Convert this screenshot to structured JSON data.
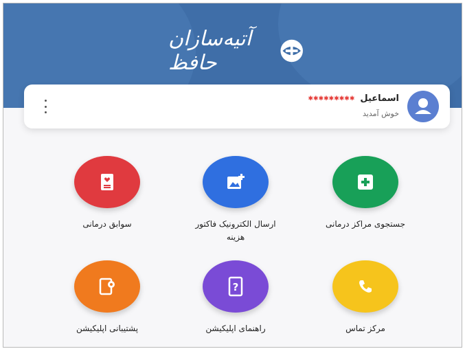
{
  "app": {
    "logo_text": "آتیه‌سازان حافظ"
  },
  "user": {
    "name": "اسماعیل",
    "masked_name": "✱✱✱✱✱✱✱✱✱",
    "greeting": "خوش آمدید"
  },
  "services": [
    {
      "label": "جستجوی مراکز درمانی",
      "icon": "plus-icon",
      "color": "#18a058"
    },
    {
      "label": "ارسال الکترونیک فاکتور هزینه",
      "icon": "image-add-icon",
      "color": "#2f6fe0"
    },
    {
      "label": "سوابق درمانی",
      "icon": "medical-record-icon",
      "color": "#e03a3f"
    },
    {
      "label": "مرکز تماس",
      "icon": "phone-icon",
      "color": "#f6c41c"
    },
    {
      "label": "راهنمای اپلیکیشن",
      "icon": "help-icon",
      "color": "#7a4bd6"
    },
    {
      "label": "پشتیبانی اپلیکیشن",
      "icon": "settings-tablet-icon",
      "color": "#f07a1e"
    }
  ]
}
